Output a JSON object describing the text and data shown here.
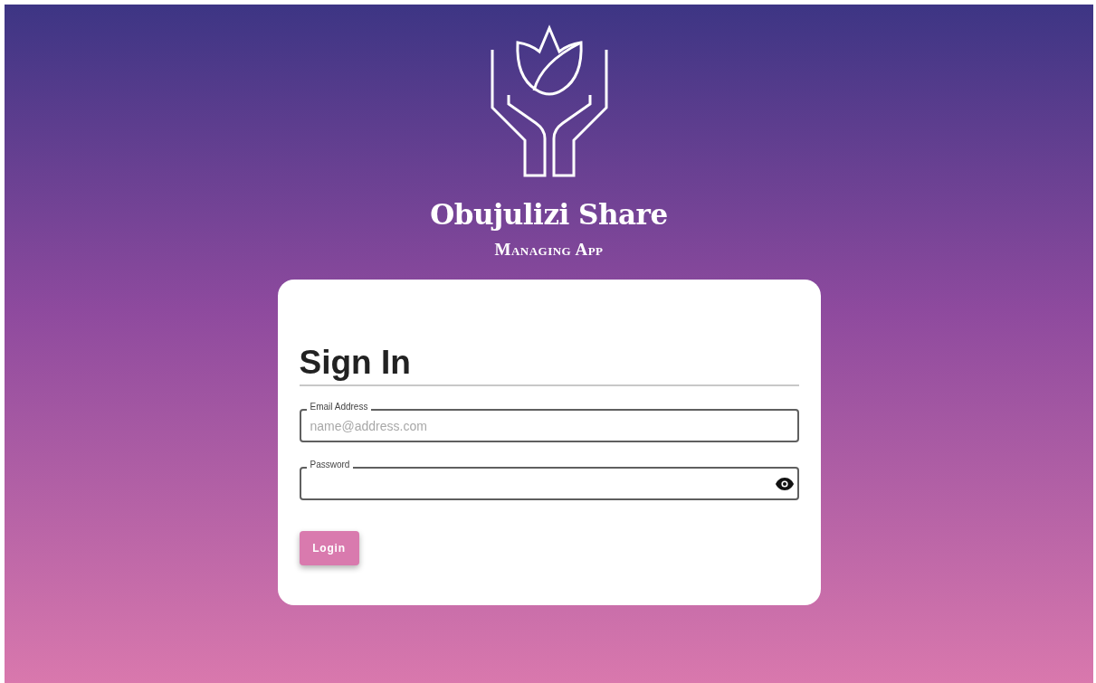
{
  "brand": {
    "title": "Obujulizi Share",
    "subtitle": "Managing App"
  },
  "form": {
    "heading": "Sign In",
    "fields": [
      {
        "kind": "text",
        "label": "Email Address",
        "placeholder": "name@address.com"
      },
      {
        "kind": "password",
        "label": "Password"
      }
    ],
    "submit": "Login"
  }
}
